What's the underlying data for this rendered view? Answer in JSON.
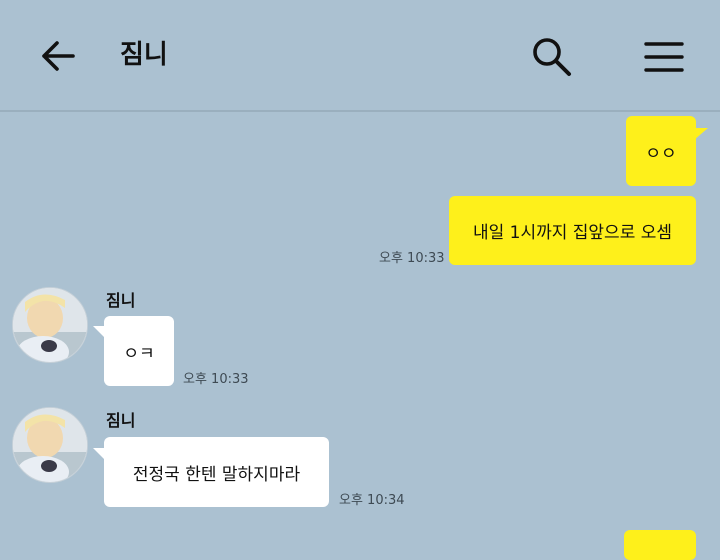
{
  "header": {
    "title": "짐니",
    "back_icon": "arrow-left-icon",
    "search_icon": "search-icon",
    "menu_icon": "hamburger-menu-icon"
  },
  "messages": [
    {
      "from": "me",
      "text": "ㅇㅇ",
      "time": ""
    },
    {
      "from": "me",
      "text": "내일 1시까지 집앞으로 오셈",
      "time": "오후 10:33"
    },
    {
      "from": "them",
      "sender": "짐니",
      "text": "ㅇㅋ",
      "time": "오후 10:33"
    },
    {
      "from": "them",
      "sender": "짐니",
      "text": "전정국 한텐 말하지마라",
      "time": "오후 10:34"
    }
  ],
  "colors": {
    "background": "#abc1d1",
    "my_bubble": "#fef01b",
    "their_bubble": "#ffffff"
  }
}
